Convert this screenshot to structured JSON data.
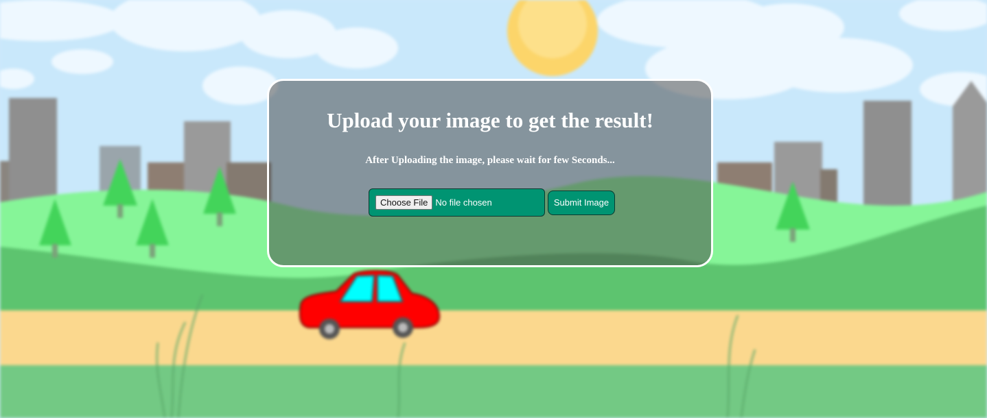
{
  "upload_panel": {
    "title": "Upload your image to get the result!",
    "subtitle": "After Uploading the image, please wait for few Seconds...",
    "choose_file_label": "Choose File",
    "file_status": "No file chosen",
    "submit_label": "Submit Image"
  },
  "colors": {
    "button_green": "#009472",
    "panel_border": "#ffffff",
    "car_red": "#ff0000",
    "sky": "#cfe9fb"
  }
}
